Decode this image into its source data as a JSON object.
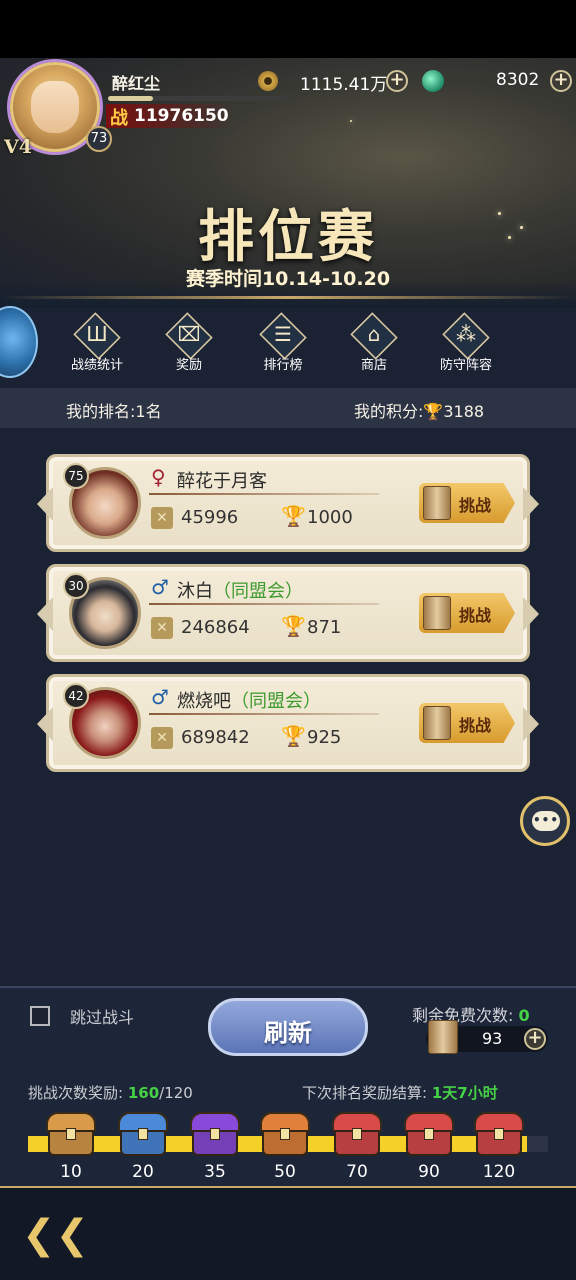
{
  "header": {
    "player_name": "醉红尘",
    "vip_level": "V4",
    "player_level": "73",
    "exp_fraction": 0.25,
    "power_label": "战",
    "power_value": "11976150",
    "coins": "1115.41万",
    "jade": "8302",
    "plus_glyph": "+"
  },
  "banner": {
    "title": "排位赛",
    "season": "赛季时间10.14-10.20"
  },
  "menu": [
    {
      "label": "战绩统计",
      "icon": "stats-icon",
      "glyph": "Ш"
    },
    {
      "label": "奖励",
      "icon": "gift-icon",
      "glyph": "⌧"
    },
    {
      "label": "排行榜",
      "icon": "leaderboard-icon",
      "glyph": "☰"
    },
    {
      "label": "商店",
      "icon": "shop-icon",
      "glyph": "⌂"
    },
    {
      "label": "防守阵容",
      "icon": "formation-icon",
      "glyph": "⁂"
    }
  ],
  "rank_bar": {
    "my_rank": "我的排名:1名",
    "my_score_label": "我的积分:",
    "my_score": "3188"
  },
  "opponents": [
    {
      "level": "75",
      "gender": "♀",
      "gender_color": "#a3223a",
      "name": "醉花于月客",
      "guild": "",
      "power": "45996",
      "score": "1000",
      "challenge": "挑战"
    },
    {
      "level": "30",
      "gender": "♂",
      "gender_color": "#1f5fa8",
      "name": "沐白",
      "guild": "（同盟会）",
      "power": "246864",
      "score": "871",
      "challenge": "挑战"
    },
    {
      "level": "42",
      "gender": "♂",
      "gender_color": "#1f5fa8",
      "name": "燃烧吧",
      "guild": "（同盟会）",
      "power": "689842",
      "score": "925",
      "challenge": "挑战"
    }
  ],
  "bottom": {
    "skip_label": "跳过战斗",
    "refresh_label": "刷新",
    "free_label": "剩余免费次数:",
    "free_count": "0",
    "tickets": "93",
    "progress_label": "挑战次数奖励:",
    "progress_current": "160",
    "progress_total": "/120",
    "progress_fraction": 0.96,
    "settle_label": "下次排名奖励结算:",
    "settle_time": "1天7小时"
  },
  "chests": [
    {
      "count": "10",
      "color": "#d99a4a"
    },
    {
      "count": "20",
      "color": "#4a8ad9"
    },
    {
      "count": "35",
      "color": "#8a4ad9"
    },
    {
      "count": "50",
      "color": "#e0803a"
    },
    {
      "count": "70",
      "color": "#d94a4a"
    },
    {
      "count": "90",
      "color": "#d94a4a"
    },
    {
      "count": "120",
      "color": "#d94a4a"
    }
  ]
}
